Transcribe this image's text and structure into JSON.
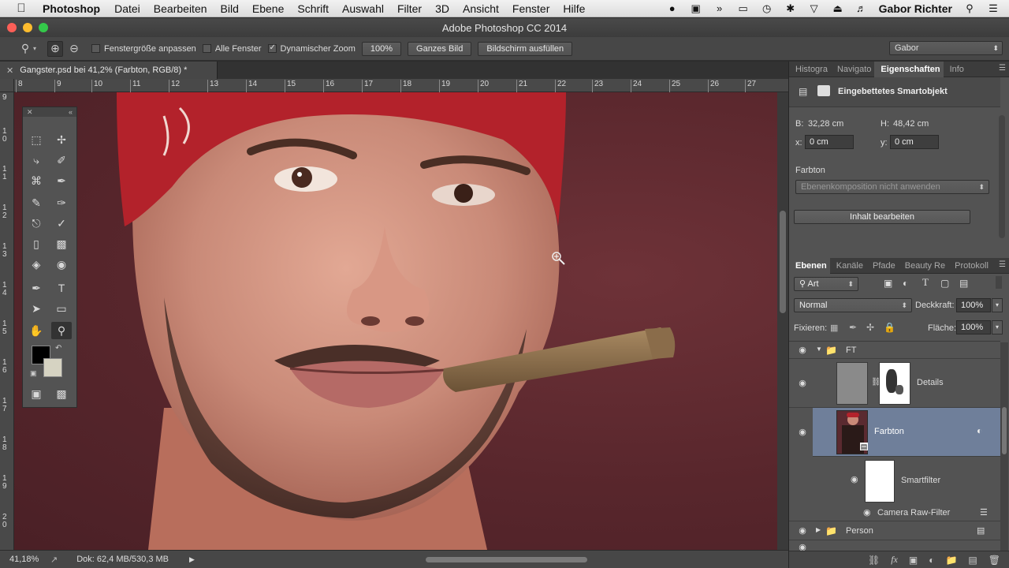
{
  "menubar": {
    "app": "Photoshop",
    "items": [
      "Datei",
      "Bearbeiten",
      "Bild",
      "Ebene",
      "Schrift",
      "Auswahl",
      "Filter",
      "3D",
      "Ansicht",
      "Fenster",
      "Hilfe"
    ],
    "user": "Gabor Richter"
  },
  "window": {
    "title": "Adobe Photoshop CC 2014"
  },
  "options": {
    "fit_window": "Fenstergröße anpassen",
    "all_windows": "Alle Fenster",
    "dynamic_zoom": "Dynamischer Zoom",
    "zoom_100": "100%",
    "whole_image": "Ganzes Bild",
    "fill_screen": "Bildschirm ausfüllen",
    "workspace": "Gabor"
  },
  "document": {
    "tab_title": "Gangster.psd bei 41,2% (Farbton, RGB/8) *",
    "ruler_top": [
      "8",
      "9",
      "10",
      "11",
      "12",
      "13",
      "14",
      "15",
      "16",
      "17",
      "18",
      "19",
      "20",
      "21",
      "22",
      "23",
      "24",
      "25",
      "26",
      "27"
    ],
    "ruler_left": [
      "9",
      "1 0",
      "1 1",
      "1 2",
      "1 3",
      "1 4",
      "1 5",
      "1 6",
      "1 7",
      "1 8",
      "1 9",
      "2 0"
    ]
  },
  "status": {
    "zoom": "41,18%",
    "doc": "Dok: 62,4 MB/530,3 MB"
  },
  "properties": {
    "tabs": [
      "Histogra",
      "Navigato",
      "Eigenschaften",
      "Info"
    ],
    "active_tab": "Eigenschaften",
    "title": "Eingebettetes Smartobjekt",
    "width_label": "B:",
    "width_value": "32,28 cm",
    "height_label": "H:",
    "height_value": "48,42 cm",
    "x_label": "x:",
    "x_value": "0 cm",
    "y_label": "y:",
    "y_value": "0 cm",
    "comp_label": "Farbton",
    "comp_select": "Ebenenkomposition nicht anwenden",
    "edit_button": "Inhalt bearbeiten"
  },
  "layers_panel": {
    "tabs": [
      "Ebenen",
      "Kanäle",
      "Pfade",
      "Beauty Re",
      "Protokoll"
    ],
    "active_tab": "Ebenen",
    "filter": "Art",
    "blend_mode": "Normal",
    "opacity_label": "Deckkraft:",
    "opacity": "100%",
    "lock_label": "Fixieren:",
    "fill_label": "Fläche:",
    "fill": "100%",
    "layers": {
      "group_ft": "FT",
      "details": "Details",
      "farbton": "Farbton",
      "smartfilter": "Smartfilter",
      "camera_raw": "Camera Raw-Filter",
      "person": "Person"
    }
  }
}
